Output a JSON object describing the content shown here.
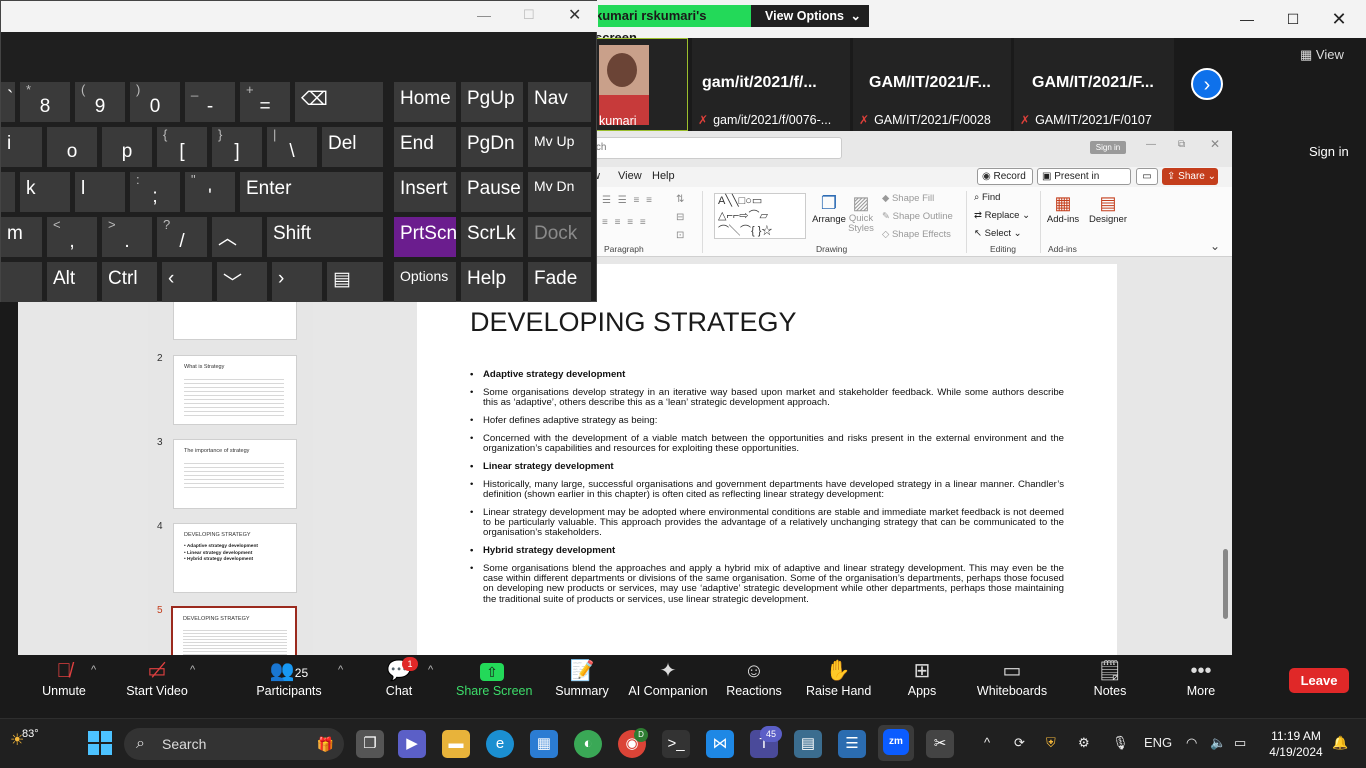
{
  "zoom": {
    "banner": "kumari rskumari's screen",
    "view_options": "View Options",
    "view_label": "View",
    "sign_in": "Sign in",
    "participants": [
      {
        "name": "",
        "sub": "kumari"
      },
      {
        "name": "gam/it/2021/f/...",
        "sub": "gam/it/2021/f/0076-..."
      },
      {
        "name": "GAM/IT/2021/F...",
        "sub": "GAM/IT/2021/F/0028"
      },
      {
        "name": "GAM/IT/2021/F...",
        "sub": "GAM/IT/2021/F/0107"
      }
    ],
    "toolbar": {
      "unmute": "Unmute",
      "start_video": "Start Video",
      "participants": "Participants",
      "participants_count": "25",
      "chat": "Chat",
      "chat_badge": "1",
      "share_screen": "Share Screen",
      "summary": "Summary",
      "ai_companion": "AI Companion",
      "reactions": "Reactions",
      "raise_hand": "Raise Hand",
      "apps": "Apps",
      "whiteboards": "Whiteboards",
      "notes": "Notes",
      "more": "More",
      "leave": "Leave"
    }
  },
  "ppt": {
    "search_placeholder": "arch",
    "sign_in": "Sign in",
    "tabs": [
      "w",
      "View",
      "Help"
    ],
    "record": "Record",
    "present_teams": "Present in Teams",
    "share": "Share",
    "groups": {
      "paragraph": "Paragraph",
      "drawing": "Drawing",
      "editing": "Editing",
      "addins": "Add-ins"
    },
    "buttons": {
      "arrange": "Arrange",
      "quick_styles": "Quick Styles",
      "shape_fill": "Shape Fill",
      "shape_outline": "Shape Outline",
      "shape_effects": "Shape Effects",
      "find": "Find",
      "replace": "Replace",
      "select": "Select",
      "addins": "Add-ins",
      "designer": "Designer"
    },
    "thumbnails": [
      {
        "num": "2",
        "title": "What is Strategy"
      },
      {
        "num": "3",
        "title": "The importance of strategy"
      },
      {
        "num": "4",
        "title": "DEVELOPING STRATEGY",
        "bullets": [
          "• Adaptive strategy development",
          "• Linear strategy development",
          "• Hybrid strategy development"
        ]
      },
      {
        "num": "5",
        "title": "DEVELOPING STRATEGY"
      }
    ],
    "slide": {
      "title": "DEVELOPING STRATEGY",
      "bullets": [
        {
          "text": "Adaptive strategy development",
          "bold": true
        },
        {
          "text": "Some organisations develop strategy in an iterative way based upon market and stakeholder feedback. While some authors describe this as ‘adaptive’, others describe this as a ‘lean’ strategic development approach.",
          "bold": false
        },
        {
          "text": "Hofer defines adaptive strategy as being:",
          "bold": false
        },
        {
          "text": "Concerned with the development of a viable match between the opportunities and risks present in the external environment and the organization’s capabilities and resources for exploiting these opportunities.",
          "bold": false
        },
        {
          "text": "Linear strategy development",
          "bold": true
        },
        {
          "text": "Historically, many large, successful organisations and government departments have developed strategy in a linear manner. Chandler’s definition (shown earlier in this chapter) is often cited as reflecting linear strategy development:",
          "bold": false
        },
        {
          "text": "Linear strategy development may be adopted where environmental conditions are stable and immediate market feedback is not deemed to be particularly valuable. This approach provides the advantage of a relatively unchanging strategy that can be communicated to the organisation’s stakeholders.",
          "bold": false
        },
        {
          "text": "Hybrid strategy development",
          "bold": true
        },
        {
          "text": "Some organisations blend the approaches and apply a hybrid mix of adaptive and linear strategy development. This may even be the case within different departments or divisions of the same organisation. Some of the organisation’s departments, perhaps those focused on developing new products or services, may use ‘adaptive’ strategic development while other departments, perhaps those maintaining the traditional suite of products or services, use linear strategic development.",
          "bold": false
        }
      ]
    }
  },
  "osk": {
    "row1": [
      {
        "shift": "*",
        "main": "8"
      },
      {
        "shift": "(",
        "main": "9"
      },
      {
        "shift": ")",
        "main": "0"
      },
      {
        "shift": "_",
        "main": "-"
      },
      {
        "shift": "+",
        "main": "="
      }
    ],
    "row2": [
      {
        "shift": "",
        "main": "o"
      },
      {
        "shift": "",
        "main": "p"
      },
      {
        "shift": "{",
        "main": "["
      },
      {
        "shift": "}",
        "main": "]"
      },
      {
        "shift": "|",
        "main": "\\"
      }
    ],
    "row3": [
      {
        "shift": "",
        "main": "k"
      },
      {
        "shift": "",
        "main": "l"
      },
      {
        "shift": ":",
        "main": ";"
      },
      {
        "shift": "\"",
        "main": "'"
      }
    ],
    "row4": [
      {
        "shift": "<",
        "main": ","
      },
      {
        "shift": ">",
        "main": "."
      },
      {
        "shift": "?",
        "main": "/"
      }
    ],
    "partial_keys": {
      "r1": "`",
      "r2": "i",
      "r4": "m"
    },
    "labels": {
      "del": "Del",
      "enter": "Enter",
      "shift": "Shift",
      "alt": "Alt",
      "ctrl": "Ctrl",
      "home": "Home",
      "pgup": "PgUp",
      "nav": "Nav",
      "end": "End",
      "pgdn": "PgDn",
      "mvup": "Mv Up",
      "insert": "Insert",
      "pause": "Pause",
      "mvdn": "Mv Dn",
      "prtscn": "PrtScn",
      "scrlk": "ScrLk",
      "dock": "Dock",
      "options": "Options",
      "help": "Help",
      "fade": "Fade"
    }
  },
  "taskbar": {
    "weather": "83°",
    "search": "Search",
    "teams_badge": "45",
    "chrome_badge": "D",
    "lang": "ENG",
    "time": "11:19 AM",
    "date": "4/19/2024"
  }
}
